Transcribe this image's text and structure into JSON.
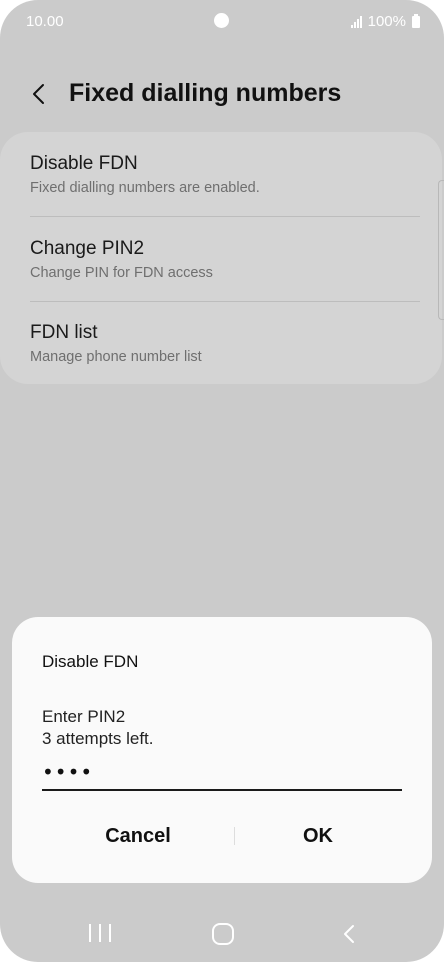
{
  "status_bar": {
    "time": "10.00",
    "battery": "100%"
  },
  "header": {
    "title": "Fixed dialling numbers",
    "back_icon": "chevron-left-icon"
  },
  "settings": {
    "items": [
      {
        "title": "Disable FDN",
        "subtitle": "Fixed dialling numbers are enabled."
      },
      {
        "title": "Change PIN2",
        "subtitle": "Change PIN for FDN access"
      },
      {
        "title": "FDN list",
        "subtitle": "Manage phone number list"
      }
    ]
  },
  "dialog": {
    "title": "Disable FDN",
    "message_line1": "Enter PIN2",
    "message_line2": "3 attempts left.",
    "pin_value": "••••",
    "cancel_label": "Cancel",
    "ok_label": "OK"
  },
  "nav_bar": {
    "recent_icon": "recent-apps-icon",
    "home_icon": "home-icon",
    "back_icon": "back-icon"
  },
  "colors": {
    "background_dim": "#cbcbcb",
    "card": "#d4d4d4",
    "dialog": "#fafafa",
    "text_primary": "#111111",
    "text_secondary": "#6f6f6f"
  }
}
